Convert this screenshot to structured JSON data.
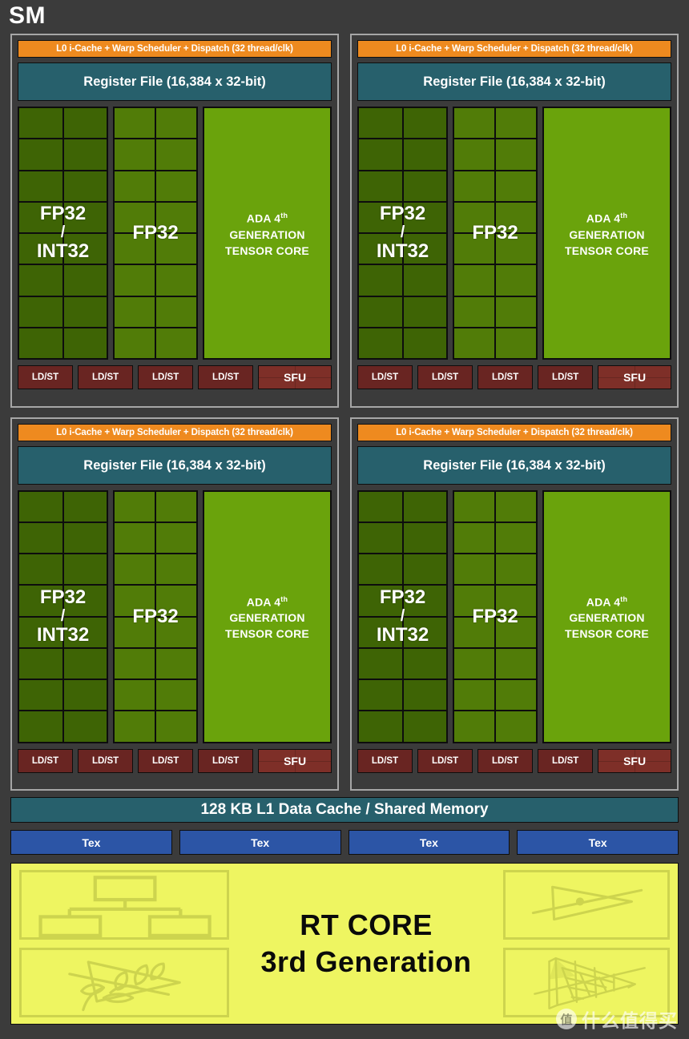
{
  "title": "SM",
  "colors": {
    "background": "#3b3b3b",
    "quadrant_border": "#a6a6a6",
    "warp_orange": "#ee8a1f",
    "register_teal": "#27606c",
    "fp32_int32_green": "#3e6405",
    "fp32_green": "#517c08",
    "tensor_green": "#6aa30c",
    "ldst_red": "#692522",
    "sfu_red": "#7e2f28",
    "tex_blue": "#2c55a6",
    "rtcore_yellow": "#eef561",
    "rtcore_line": "#cdd44e",
    "text_white": "#ffffff",
    "text_black": "#0a0a0a"
  },
  "processing_blocks": [
    {
      "id": "block-1",
      "warp_scheduler": "L0 i-Cache + Warp Scheduler + Dispatch (32 thread/clk)",
      "register_file": "Register File (16,384 x 32-bit)",
      "fp32_int32_label_line1": "FP32",
      "fp32_int32_label_line2": "/",
      "fp32_int32_label_line3": "INT32",
      "fp32_label": "FP32",
      "fp32_int32_cell_count": 16,
      "fp32_cell_count": 16,
      "tensor_core_line1_pre": "ADA 4",
      "tensor_core_line1_sup": "th",
      "tensor_core_line2": "GENERATION",
      "tensor_core_line3": "TENSOR CORE",
      "ldst_labels": [
        "LD/ST",
        "LD/ST",
        "LD/ST",
        "LD/ST"
      ],
      "sfu_label": "SFU"
    },
    {
      "id": "block-2",
      "warp_scheduler": "L0 i-Cache + Warp Scheduler + Dispatch (32 thread/clk)",
      "register_file": "Register File (16,384 x 32-bit)",
      "fp32_int32_label_line1": "FP32",
      "fp32_int32_label_line2": "/",
      "fp32_int32_label_line3": "INT32",
      "fp32_label": "FP32",
      "fp32_int32_cell_count": 16,
      "fp32_cell_count": 16,
      "tensor_core_line1_pre": "ADA 4",
      "tensor_core_line1_sup": "th",
      "tensor_core_line2": "GENERATION",
      "tensor_core_line3": "TENSOR CORE",
      "ldst_labels": [
        "LD/ST",
        "LD/ST",
        "LD/ST",
        "LD/ST"
      ],
      "sfu_label": "SFU"
    },
    {
      "id": "block-3",
      "warp_scheduler": "L0 i-Cache + Warp Scheduler + Dispatch (32 thread/clk)",
      "register_file": "Register File (16,384 x 32-bit)",
      "fp32_int32_label_line1": "FP32",
      "fp32_int32_label_line2": "/",
      "fp32_int32_label_line3": "INT32",
      "fp32_label": "FP32",
      "fp32_int32_cell_count": 16,
      "fp32_cell_count": 16,
      "tensor_core_line1_pre": "ADA 4",
      "tensor_core_line1_sup": "th",
      "tensor_core_line2": "GENERATION",
      "tensor_core_line3": "TENSOR CORE",
      "ldst_labels": [
        "LD/ST",
        "LD/ST",
        "LD/ST",
        "LD/ST"
      ],
      "sfu_label": "SFU"
    },
    {
      "id": "block-4",
      "warp_scheduler": "L0 i-Cache + Warp Scheduler + Dispatch (32 thread/clk)",
      "register_file": "Register File (16,384 x 32-bit)",
      "fp32_int32_label_line1": "FP32",
      "fp32_int32_label_line2": "/",
      "fp32_int32_label_line3": "INT32",
      "fp32_label": "FP32",
      "fp32_int32_cell_count": 16,
      "fp32_cell_count": 16,
      "tensor_core_line1_pre": "ADA 4",
      "tensor_core_line1_sup": "th",
      "tensor_core_line2": "GENERATION",
      "tensor_core_line3": "TENSOR CORE",
      "ldst_labels": [
        "LD/ST",
        "LD/ST",
        "LD/ST",
        "LD/ST"
      ],
      "sfu_label": "SFU"
    }
  ],
  "l1_cache": "128 KB L1 Data Cache / Shared Memory",
  "tex_units": [
    "Tex",
    "Tex",
    "Tex",
    "Tex"
  ],
  "rt_core": {
    "title_line1": "RT CORE",
    "title_line2": "3rd Generation",
    "diagrams": {
      "top_left": "bvh-tree-icon",
      "bottom_left": "alpha-foliage-triangle-icon",
      "top_right": "ray-triangle-intersection-icon",
      "bottom_right": "displaced-micro-mesh-triangle-icon"
    }
  },
  "watermark": {
    "badge": "值",
    "text": "什么值得买"
  }
}
